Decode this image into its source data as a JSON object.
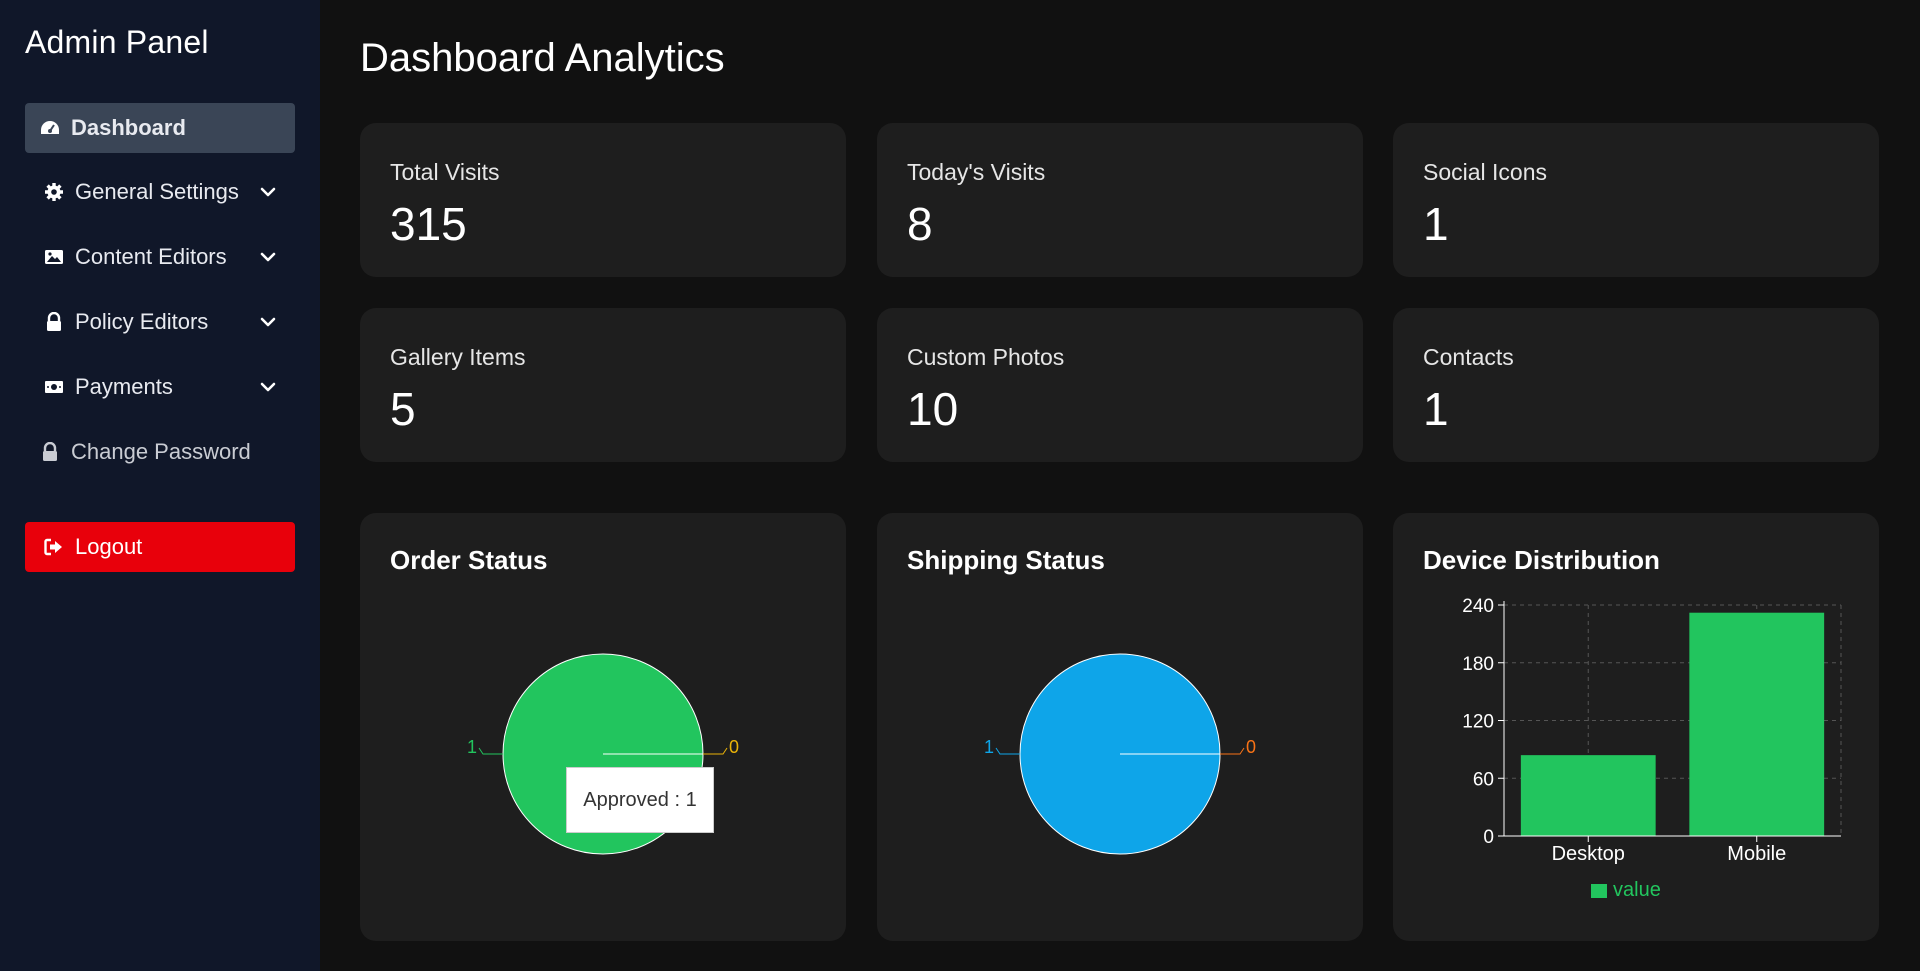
{
  "sidebar": {
    "title": "Admin Panel",
    "items": [
      {
        "label": "Dashboard",
        "icon": "gauge-icon"
      },
      {
        "label": "General Settings",
        "icon": "gear-icon"
      },
      {
        "label": "Content Editors",
        "icon": "image-icon"
      },
      {
        "label": "Policy Editors",
        "icon": "lock-icon"
      },
      {
        "label": "Payments",
        "icon": "money-icon"
      },
      {
        "label": "Change Password",
        "icon": "lock-icon"
      }
    ],
    "logout": {
      "label": "Logout",
      "icon": "sign-out-icon"
    }
  },
  "page": {
    "title": "Dashboard Analytics"
  },
  "stats": [
    {
      "label": "Total Visits",
      "value": "315"
    },
    {
      "label": "Today's Visits",
      "value": "8"
    },
    {
      "label": "Social Icons",
      "value": "1"
    },
    {
      "label": "Gallery Items",
      "value": "5"
    },
    {
      "label": "Custom Photos",
      "value": "10"
    },
    {
      "label": "Contacts",
      "value": "1"
    }
  ],
  "charts": {
    "order_title": "Order Status",
    "shipping_title": "Shipping Status",
    "device_title": "Device Distribution",
    "tooltip": "Approved : 1"
  },
  "colors": {
    "accent_green": "#22c55e",
    "accent_blue": "#0ea5e9",
    "pie_zero_order": "#eab308",
    "pie_zero_shipping": "#f97316",
    "logout_red": "#e8000b"
  },
  "chart_data": [
    {
      "type": "pie",
      "title": "Order Status",
      "slices": [
        {
          "label": "Approved",
          "value": 1,
          "color": "#22c55e"
        },
        {
          "label": "",
          "value": 0,
          "color": "#eab308"
        }
      ],
      "labels_shown": [
        "1",
        "0"
      ]
    },
    {
      "type": "pie",
      "title": "Shipping Status",
      "slices": [
        {
          "label": "",
          "value": 1,
          "color": "#0ea5e9"
        },
        {
          "label": "",
          "value": 0,
          "color": "#f97316"
        }
      ],
      "labels_shown": [
        "1",
        "0"
      ]
    },
    {
      "type": "bar",
      "title": "Device Distribution",
      "categories": [
        "Desktop",
        "Mobile"
      ],
      "series": [
        {
          "name": "value",
          "values": [
            84,
            232
          ]
        }
      ],
      "ylim": [
        0,
        240
      ],
      "yticks": [
        "0",
        "60",
        "120",
        "180",
        "240"
      ],
      "grid": true,
      "legend": "bottom"
    }
  ]
}
